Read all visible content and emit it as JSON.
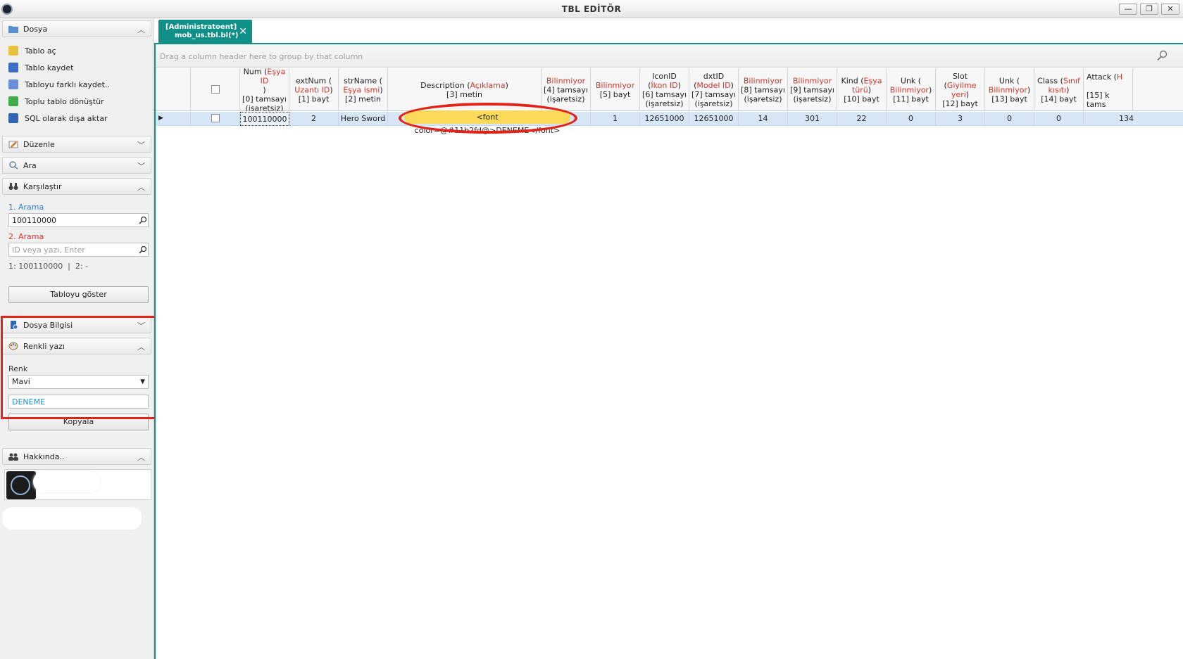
{
  "window": {
    "title": "TBL EDİTÖR",
    "buttons": {
      "minimize": "—",
      "restore": "❐",
      "close": "✕"
    }
  },
  "sidebar": {
    "dosya": {
      "title": "Dosya",
      "items": [
        {
          "label": "Tablo aç",
          "icon": "folder-open-icon"
        },
        {
          "label": "Tablo kaydet",
          "icon": "save-icon"
        },
        {
          "label": "Tabloyu farklı kaydet..",
          "icon": "save-as-icon"
        },
        {
          "label": "Toplu tablo dönüştür",
          "icon": "convert-icon"
        },
        {
          "label": "SQL olarak dışa aktar",
          "icon": "sql-export-icon"
        }
      ]
    },
    "duzenle": {
      "title": "Düzenle"
    },
    "ara": {
      "title": "Ara"
    },
    "karsilastir": {
      "title": "Karşılaştır",
      "search1_label": "1. Arama",
      "search1_value": "100110000",
      "search2_label": "2. Arama",
      "search2_placeholder": "ID veya yazı, Enter",
      "status": "1: 100110000  |  2: -",
      "show_button": "Tabloyu göster"
    },
    "dosya_bilgisi": {
      "title": "Dosya Bilgisi"
    },
    "renkli_yazi": {
      "title": "Renkli yazı",
      "color_label": "Renk",
      "color_value": "Mavi",
      "text_value": "DENEME",
      "text_color": "#1b8fd6",
      "copy_button": "Kopyala"
    },
    "hakkinda": {
      "title": "Hakkında.."
    }
  },
  "tab": {
    "line1": "[Administratoent]",
    "line2": "mob_us.tbl.bl(*)",
    "close": "✕"
  },
  "grid": {
    "group_hint": "Drag a column header here to group by that column",
    "headers": {
      "num": {
        "a": "Num (",
        "b": "Eşya ID",
        "c": ")",
        "d": "[0] tamsayı",
        "e": "(işaretsiz)"
      },
      "extnum": {
        "a": "extNum (",
        "b": "Uzantı ID",
        "c": ")",
        "d": "[1] bayt"
      },
      "strname": {
        "a": "strName (",
        "b": "Eşya ismi",
        "c": ")",
        "d": "[2] metin"
      },
      "description": {
        "a": "Description (",
        "b": "Açıklama",
        "c": ")",
        "d": "[3] metin"
      },
      "col4": {
        "a": "Bilinmiyor",
        "b": "[4] tamsayı",
        "c": "(işaretsiz)"
      },
      "col5": {
        "a": "Bilinmiyor",
        "b": "[5] bayt"
      },
      "iconid": {
        "a": "IconID (",
        "b": "İkon ID",
        "c": ")",
        "d": "[6] tamsayı",
        "e": "(işaretsiz)"
      },
      "dxtid": {
        "a": "dxtID (",
        "b": "Model ID",
        "c": ")",
        "d": "[7] tamsayı",
        "e": "(işaretsiz)"
      },
      "col8": {
        "a": "Bilinmiyor",
        "b": "[8] tamsayı",
        "c": "(işaretsiz)"
      },
      "col9": {
        "a": "Bilinmiyor",
        "b": "[9] tamsayı",
        "c": "(işaretsiz)"
      },
      "kind": {
        "a": "Kind (",
        "b": "Eşya türü",
        "c": ")",
        "d": "[10] bayt"
      },
      "unk11": {
        "a": "Unk (",
        "b": "Bilinmiyor",
        "c": ")",
        "d": "[11] bayt"
      },
      "slot": {
        "a": "Slot (",
        "b": "Giyilme yeri",
        "c": ")",
        "d": "[12] bayt"
      },
      "unk13": {
        "a": "Unk (",
        "b": "Bilinmiyor",
        "c": ")",
        "d": "[13] bayt"
      },
      "class": {
        "a": "Class (",
        "b": "Sınıf kısıtı",
        "c": ")",
        "d": "[14] bayt"
      },
      "attack": {
        "a": "Attack (",
        "b": "H",
        "d": "[15] k",
        "e": "tams"
      }
    },
    "row": {
      "num": "100110000",
      "extnum": "2",
      "strname": "Hero Sword",
      "description": "<font color=@#11b2fd@>DENEME</font>",
      "col4": "1",
      "col5": "1",
      "iconid": "12651000",
      "dxtid": "12651000",
      "col8": "14",
      "col9": "301",
      "kind": "22",
      "unk11": "0",
      "slot": "3",
      "unk13": "0",
      "class": "0",
      "attack": "134"
    }
  }
}
